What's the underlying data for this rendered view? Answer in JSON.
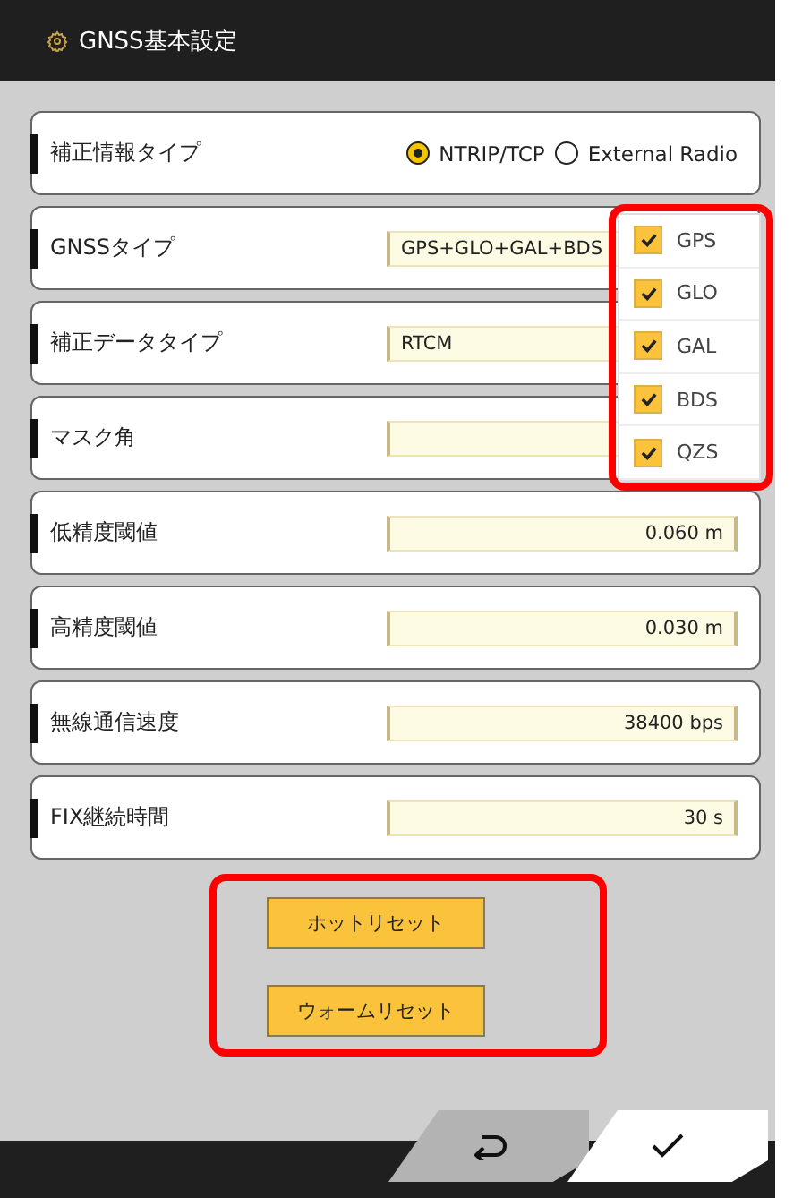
{
  "title": "GNSS基本設定",
  "rows": [
    {
      "kind": "radio",
      "label": "補正情報タイプ",
      "options": [
        {
          "label": "NTRIP/TCP",
          "selected": true
        },
        {
          "label": "External Radio",
          "selected": false
        }
      ]
    },
    {
      "kind": "select",
      "label": "GNSSタイプ",
      "value": "GPS+GLO+GAL+BDS"
    },
    {
      "kind": "select",
      "label": "補正データタイプ",
      "value": "RTCM"
    },
    {
      "kind": "number",
      "label": "マスク角"
    },
    {
      "kind": "number",
      "label": "低精度閾値",
      "value": "0.060 m"
    },
    {
      "kind": "number",
      "label": "高精度閾値",
      "value": "0.030 m"
    },
    {
      "kind": "number",
      "label": "無線通信速度",
      "value": "38400 bps"
    },
    {
      "kind": "number",
      "label": "FIX継続時間",
      "value": "30 s"
    }
  ],
  "dropdown": [
    {
      "label": "GPS",
      "checked": true
    },
    {
      "label": "GLO",
      "checked": true
    },
    {
      "label": "GAL",
      "checked": true
    },
    {
      "label": "BDS",
      "checked": true
    },
    {
      "label": "QZS",
      "checked": true
    }
  ],
  "reset_buttons": [
    "ホットリセット",
    "ウォームリセット"
  ]
}
